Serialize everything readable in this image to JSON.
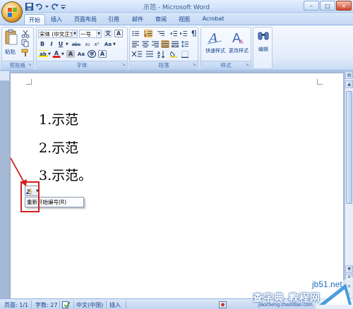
{
  "window": {
    "title": "示范 - Microsoft Word",
    "controls": {
      "minimize": "–",
      "maximize": "□",
      "close": "×"
    }
  },
  "tabs": [
    {
      "label": "开始",
      "active": true
    },
    {
      "label": "插入",
      "active": false
    },
    {
      "label": "页面布局",
      "active": false
    },
    {
      "label": "引用",
      "active": false
    },
    {
      "label": "邮件",
      "active": false
    },
    {
      "label": "审阅",
      "active": false
    },
    {
      "label": "视图",
      "active": false
    },
    {
      "label": "Acrobat",
      "active": false
    }
  ],
  "ribbon": {
    "clipboard": {
      "label": "剪贴板",
      "paste_label": "粘贴"
    },
    "font": {
      "label": "字体",
      "font_name": "宋体 (中文正文)",
      "font_size": "一号",
      "btn_wen": "文",
      "btn_a_border": "A",
      "btn_bold": "B",
      "btn_italic": "I",
      "btn_underline": "U",
      "btn_strike": "abc",
      "btn_sub": "x₂",
      "btn_sup": "x²",
      "btn_aa": "Aa",
      "btn_font_color": "A",
      "btn_highlight": "ab",
      "btn_a_shade": "A",
      "btn_aa2": "Aa",
      "btn_circle": "字",
      "btn_grow": "A"
    },
    "paragraph": {
      "label": "段落"
    },
    "styles": {
      "label": "样式",
      "quick_styles": "快速样式",
      "change_styles": "更改样式"
    },
    "editing": {
      "label": "编辑"
    }
  },
  "document": {
    "items": [
      {
        "text": "1.示范"
      },
      {
        "text": "2.示范"
      },
      {
        "text": "3.示范。"
      }
    ],
    "autocorrect_menu": {
      "item": "重新开始编号(R)"
    }
  },
  "statusbar": {
    "page": "页面: 1/1",
    "words": "字数: 27",
    "language": "中文(中国)",
    "mode": "插入"
  },
  "watermark": {
    "line1": "jb51.net",
    "line2": "查字典 教程网",
    "line3": "jiaocheng.chazidian.com"
  },
  "colors": {
    "accent_blue": "#15428b",
    "ribbon_bg": "#e3edfb",
    "annotation_red": "#d31f1f",
    "font_color_red": "#e02020",
    "highlight_yellow": "#ffe600"
  }
}
